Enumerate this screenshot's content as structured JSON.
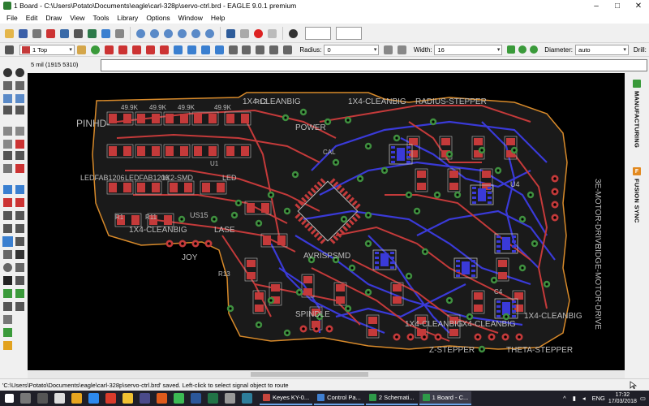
{
  "window": {
    "title": "1 Board - C:\\Users\\Potato\\Documents\\eagle\\carl-328p\\servo-ctrl.brd - EAGLE 9.0.1 premium",
    "controls": [
      "–",
      "□",
      "✕"
    ]
  },
  "menu": [
    "File",
    "Edit",
    "Draw",
    "View",
    "Tools",
    "Library",
    "Options",
    "Window",
    "Help"
  ],
  "toolbar2": {
    "layer": "1 Top",
    "layer_color": "#c43a3a",
    "radius_label": "Radius:",
    "radius_value": "0",
    "width_label": "Width:",
    "width_value": "16",
    "diameter_label": "Diameter:",
    "diameter_value": "auto",
    "drill_label": "Drill:"
  },
  "command": {
    "coordinate": "5 mil (1915 5310)",
    "input_value": ""
  },
  "right_panel": {
    "manufacturing_label": "MANUFACTURING",
    "fusion_badge": "F",
    "fusion_label": "FUSION SYNC"
  },
  "board_labels": [
    "PINHD-",
    "1X4-CLEANBIG",
    "1X4-CLEANBIG",
    "RADIUS-STEPPER",
    "POWER",
    "LEDFAB1206",
    "LEDFAB1206",
    "LED",
    "1X2-SMD",
    "US15",
    "1X4-CLEANBIG",
    "LASE",
    "JOY",
    "AVRISPSMD",
    "SPINDLE",
    "1X4-CLEANBIG",
    "1X4-CLEANBIG",
    "1X4-CLEANBIG",
    "THETA-STEPPER",
    "Z-STEPPER",
    "3E-MOTOR-DRIVE",
    "RIDGE-MOTOR-DRIVE",
    "49.9K",
    "49.9K",
    "49.9K",
    "49.9K",
    "R1",
    "R11",
    "R12",
    "R13",
    "C4",
    "U1",
    "U4",
    "CAL"
  ],
  "status": {
    "message": "'C:\\Users\\Potato\\Documents\\eagle\\carl-328p\\servo-ctrl.brd' saved.  Left-click to select signal object to route"
  },
  "taskbar": {
    "apps": [
      {
        "label": "Keyes KY-0...",
        "color": "#c9463d"
      },
      {
        "label": "Control Pa...",
        "color": "#3f7fd1"
      },
      {
        "label": "2 Schemati...",
        "color": "#2e9a49"
      },
      {
        "label": "1 Board - C...",
        "color": "#2e9a49",
        "active": true
      }
    ],
    "lang": "ENG",
    "time": "17:32",
    "date": "17/03/2018"
  },
  "colors": {
    "canvas": "#000000",
    "board_fill": "#1a1a1a",
    "board_outline": "#d88a2a",
    "top_copper": "#c43a3a",
    "bottom_copper": "#3a3ad8",
    "via": "#3f8f3f",
    "silk": "#bdbdbd"
  }
}
